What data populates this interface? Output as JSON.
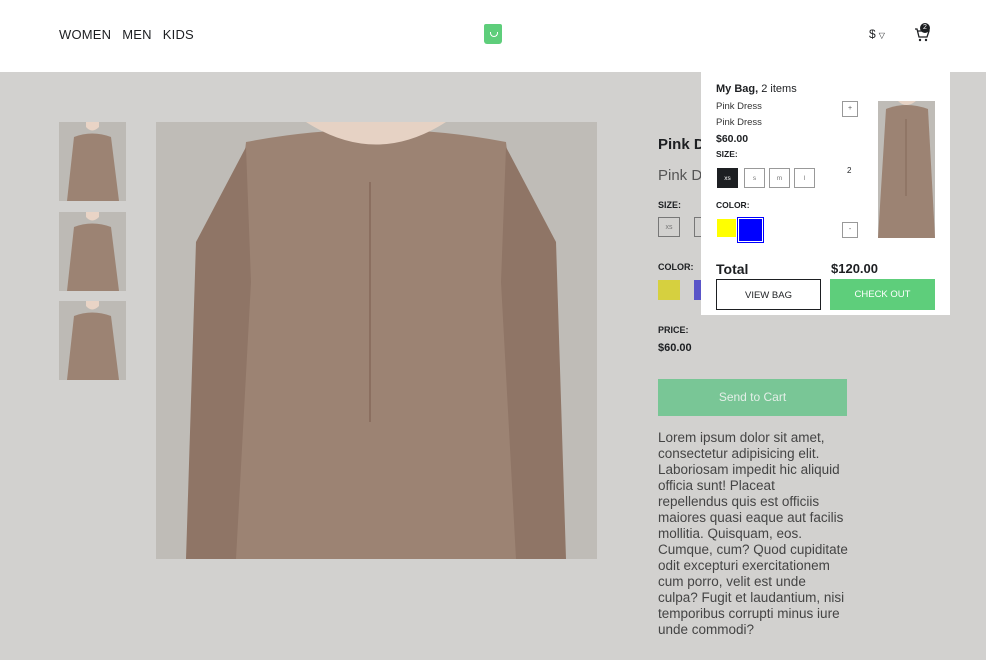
{
  "nav": {
    "items": [
      "WOMEN",
      "MEN",
      "KIDS"
    ]
  },
  "header": {
    "currency_symbol": "$",
    "cart_count": "2",
    "logo_color": "#5ece7b"
  },
  "product": {
    "brand": "Pink D",
    "name": "Pink D",
    "size_label": "SIZE:",
    "sizes": [
      "xs"
    ],
    "color_label": "COLOR:",
    "colors": [
      "#d6d03f",
      "#5a55c8"
    ],
    "price_label": "PRICE:",
    "price": "$60.00",
    "send_button": "Send to Cart",
    "description": "Lorem ipsum dolor sit amet, consectetur adipisicing elit. Laboriosam impedit hic aliquid officia sunt! Placeat repellendus quis est officiis maiores quasi eaque aut facilis mollitia. Quisquam, eos. Cumque, cum? Quod cupiditate odit excepturi exercitationem cum porro, velit est unde culpa? Fugit et laudantium, nisi temporibus corrupti minus iure unde commodi?"
  },
  "bag": {
    "title_bold": "My Bag,",
    "title_rest": " 2 items",
    "brand": "Pink Dress",
    "name": "Pink Dress",
    "price": "$60.00",
    "size_label": "SIZE:",
    "sizes": [
      "xs",
      "s",
      "m",
      "l"
    ],
    "selected_size": "xs",
    "color_label": "COLOR:",
    "colors": [
      "#ffff00",
      "#0000ff"
    ],
    "qty_plus": "+",
    "qty": "2",
    "qty_minus": "-",
    "total_label": "Total",
    "total_value": "$120.00",
    "view_bag": "VIEW BAG",
    "checkout": "CHECK OUT"
  }
}
